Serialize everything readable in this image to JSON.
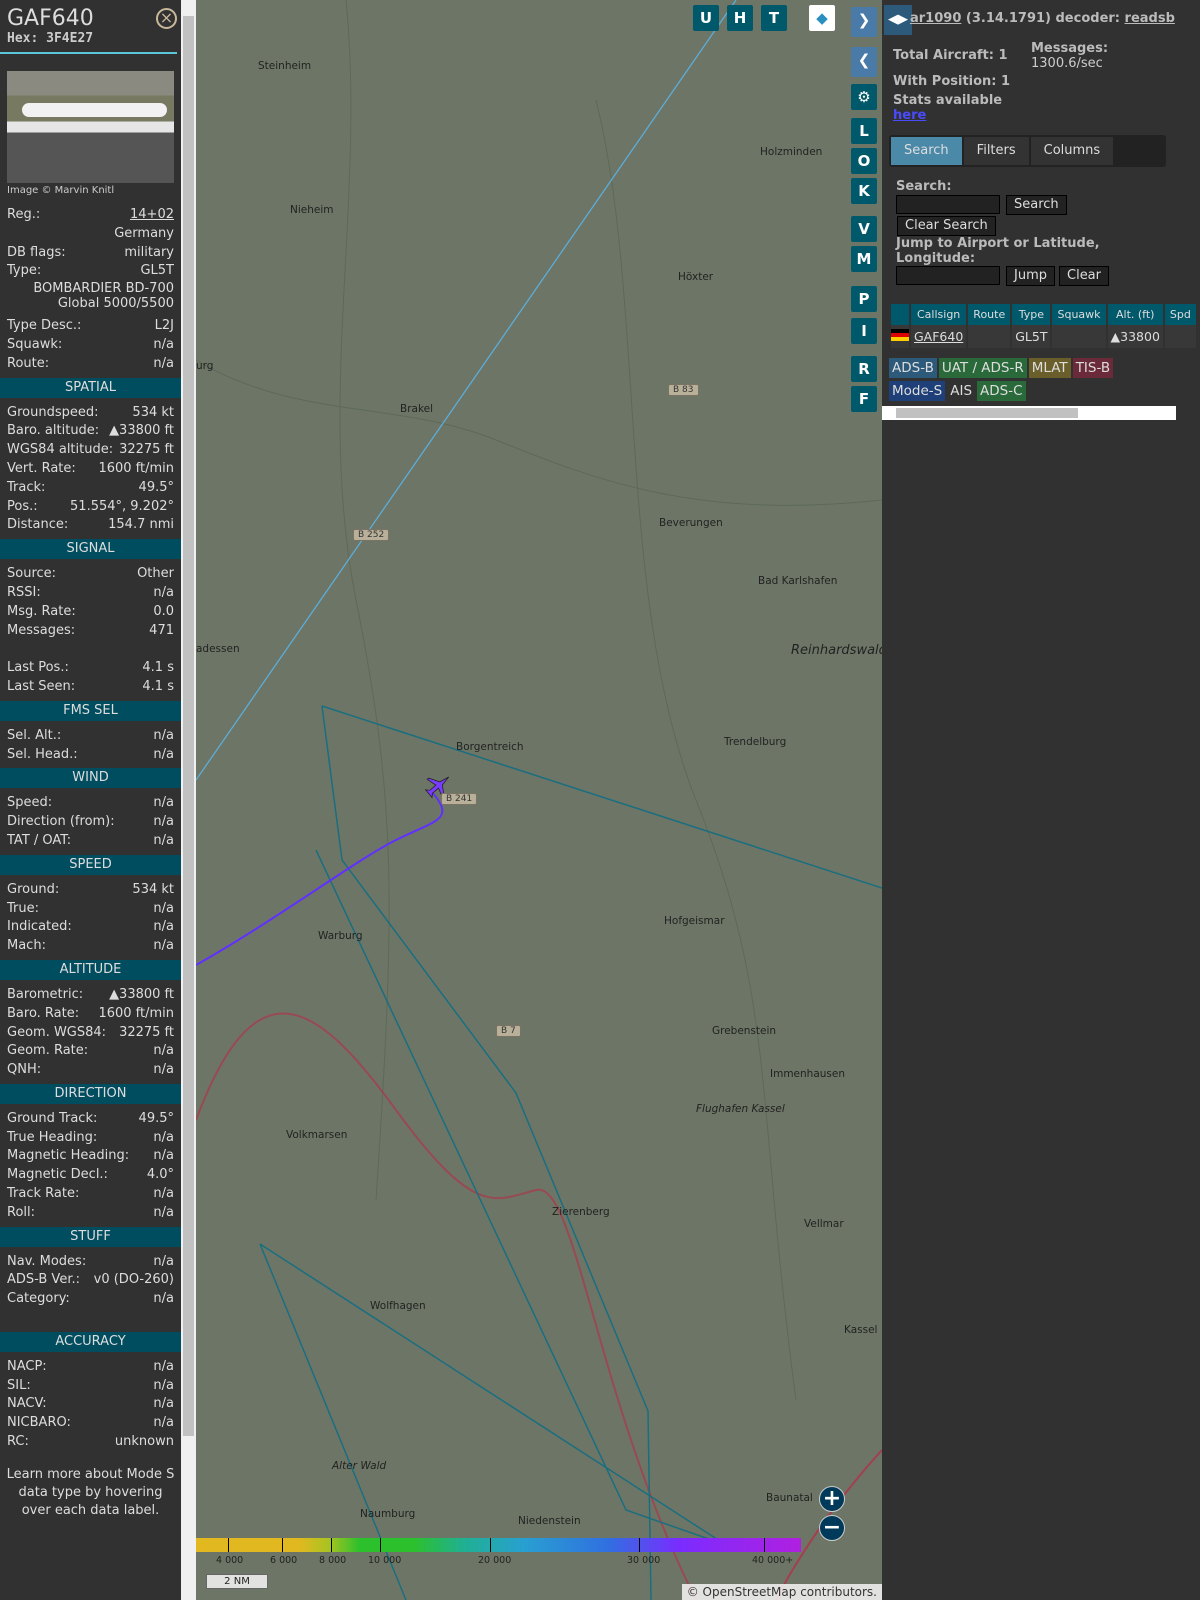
{
  "aircraft": {
    "callsign": "GAF640",
    "hex_label": "Hex:",
    "hex": "3F4E27",
    "image_credit": "Image © Marvin Knitl",
    "reg_label": "Reg.:",
    "reg": "14+02",
    "country": "Germany",
    "dbflags_label": "DB flags:",
    "dbflags": "military",
    "type_label": "Type:",
    "type": "GL5T",
    "type_name1": "BOMBARDIER BD-700",
    "type_name2": "Global 5000/5500",
    "typedesc_label": "Type Desc.:",
    "typedesc": "L2J",
    "squawk_label": "Squawk:",
    "squawk": "n/a",
    "route_label": "Route:",
    "route": "n/a"
  },
  "sections": [
    {
      "title": "SPATIAL",
      "rows": [
        [
          "Groundspeed:",
          "534 kt"
        ],
        [
          "Baro. altitude:",
          "▲33800 ft"
        ],
        [
          "WGS84 altitude:",
          "32275 ft"
        ],
        [
          "Vert. Rate:",
          "1600 ft/min"
        ],
        [
          "Track:",
          "49.5°"
        ],
        [
          "Pos.:",
          "51.554°, 9.202°"
        ],
        [
          "Distance:",
          "154.7 nmi"
        ]
      ]
    },
    {
      "title": "SIGNAL",
      "rows": [
        [
          "Source:",
          "Other"
        ],
        [
          "RSSI:",
          "n/a"
        ],
        [
          "Msg. Rate:",
          "0.0"
        ],
        [
          "Messages:",
          "471"
        ],
        [
          "",
          ""
        ],
        [
          "Last Pos.:",
          "4.1 s"
        ],
        [
          "Last Seen:",
          "4.1 s"
        ]
      ]
    },
    {
      "title": "FMS SEL",
      "rows": [
        [
          "Sel. Alt.:",
          "n/a"
        ],
        [
          "Sel. Head.:",
          "n/a"
        ]
      ]
    },
    {
      "title": "WIND",
      "rows": [
        [
          "Speed:",
          "n/a"
        ],
        [
          "Direction (from):",
          "n/a"
        ],
        [
          "TAT / OAT:",
          "n/a"
        ]
      ]
    },
    {
      "title": "SPEED",
      "rows": [
        [
          "Ground:",
          "534 kt"
        ],
        [
          "True:",
          "n/a"
        ],
        [
          "Indicated:",
          "n/a"
        ],
        [
          "Mach:",
          "n/a"
        ]
      ]
    },
    {
      "title": "ALTITUDE",
      "rows": [
        [
          "Barometric:",
          "▲33800 ft"
        ],
        [
          "Baro. Rate:",
          "1600 ft/min"
        ],
        [
          "Geom. WGS84:",
          "32275 ft"
        ],
        [
          "Geom. Rate:",
          "n/a"
        ],
        [
          "QNH:",
          "n/a"
        ]
      ]
    },
    {
      "title": "DIRECTION",
      "rows": [
        [
          "Ground Track:",
          "49.5°"
        ],
        [
          "True Heading:",
          "n/a"
        ],
        [
          "Magnetic Heading:",
          "n/a"
        ],
        [
          "Magnetic Decl.:",
          "4.0°"
        ],
        [
          "Track Rate:",
          "n/a"
        ],
        [
          "Roll:",
          "n/a"
        ]
      ]
    },
    {
      "title": "STUFF",
      "rows": [
        [
          "Nav. Modes:",
          "n/a"
        ],
        [
          "ADS-B Ver.:",
          "v0 (DO-260)"
        ],
        [
          "Category:",
          "n/a"
        ],
        [
          "",
          ""
        ]
      ]
    },
    {
      "title": "ACCURACY",
      "rows": [
        [
          "NACP:",
          "n/a"
        ],
        [
          "SIL:",
          "n/a"
        ],
        [
          "NACV:",
          "n/a"
        ],
        [
          "NICBARO:",
          "n/a"
        ],
        [
          "RC:",
          "unknown"
        ]
      ]
    }
  ],
  "learn_more": "Learn more about Mode S data type by hovering over each data label.",
  "map": {
    "buttons_top": [
      "U",
      "H",
      "T"
    ],
    "buttons_side": [
      "L",
      "O",
      "K",
      "V",
      "M",
      "P",
      "I",
      "R",
      "F"
    ],
    "towns": [
      "Steinheim",
      "Holzminden",
      "Nieheim",
      "Höxter",
      "Brakel",
      "Beverungen",
      "Bad Karlshafen",
      "Reinhardswald",
      "adessen",
      "Borgentreich",
      "Trendelburg",
      "Warburg",
      "Hofgeismar",
      "Grebenstein",
      "Immenhausen",
      "Volkmarsen",
      "Flughafen Kassel",
      "Zierenberg",
      "Vellmar",
      "Wolfhagen",
      "Kassel",
      "Baunatal",
      "Naumburg",
      "Alter Wald",
      "Niedenstein",
      "urg"
    ],
    "roads": [
      "B 83",
      "B 252",
      "B 241",
      "B 7"
    ],
    "legend_ticks": [
      "4 000",
      "6 000",
      "8 000",
      "10 000",
      "20 000",
      "30 000",
      "40 000+"
    ],
    "scale": "2 NM",
    "attribution_prefix": "© ",
    "attribution_link": "OpenStreetMap",
    "attribution_suffix": " contributors."
  },
  "right": {
    "title_link": "ar1090",
    "version": " (3.14.1791) decoder: ",
    "decoder": "readsb",
    "total_label": "Total Aircraft: 1",
    "messages_label": "Messages:",
    "messages_rate": "1300.6/sec",
    "with_pos": "With Position: 1",
    "stats": "Stats available",
    "here": "here",
    "tabs": [
      "Search",
      "Filters",
      "Columns"
    ],
    "search_label": "Search:",
    "search_btn": "Search",
    "clear_search": "Clear Search",
    "jump_label": "Jump to Airport or Latitude, Longitude:",
    "jump_btn": "Jump",
    "clear_btn": "Clear",
    "columns": [
      "",
      "Callsign",
      "Route",
      "Type",
      "Squawk",
      "Alt. (ft)",
      "Spd"
    ],
    "row": {
      "callsign": "GAF640",
      "route": "",
      "type": "GL5T",
      "squawk": "",
      "alt": "▲33800"
    },
    "sources": [
      {
        "label": "ADS-B",
        "color": "#2d5a7a"
      },
      {
        "label": "UAT / ADS-R",
        "color": "#2a6a3a"
      },
      {
        "label": "MLAT",
        "color": "#6a5f2a"
      },
      {
        "label": "TIS-B",
        "color": "#6a2a3a"
      },
      {
        "label": "Mode-S",
        "color": "#1f3f78"
      },
      {
        "label": "AIS",
        "color": "#313131"
      },
      {
        "label": "ADS-C",
        "color": "#2a6a3a"
      }
    ]
  }
}
